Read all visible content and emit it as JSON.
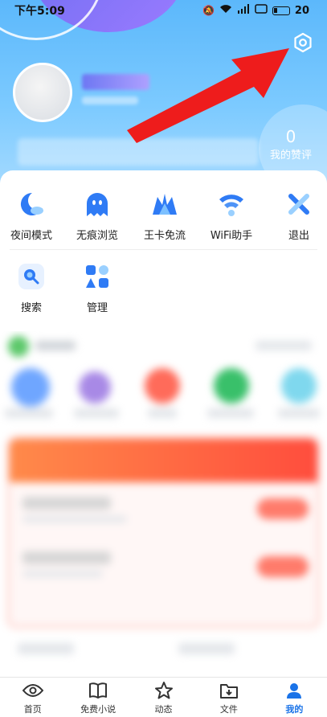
{
  "status_bar": {
    "time": "下午5:09",
    "battery": "20"
  },
  "profile": {
    "praise_count": "0",
    "praise_label": "我的赞评"
  },
  "tools": [
    {
      "label": "夜间模式",
      "icon": "moon-icon"
    },
    {
      "label": "无痕浏览",
      "icon": "ghost-icon"
    },
    {
      "label": "王卡免流",
      "icon": "crown-icon"
    },
    {
      "label": "WiFi助手",
      "icon": "wifi-icon"
    },
    {
      "label": "退出",
      "icon": "close-icon"
    },
    {
      "label": "搜索",
      "icon": "search-icon"
    },
    {
      "label": "管理",
      "icon": "manage-icon"
    }
  ],
  "bottom_nav": [
    {
      "label": "首页",
      "icon": "eye-icon"
    },
    {
      "label": "免费小说",
      "icon": "book-icon"
    },
    {
      "label": "动态",
      "icon": "star-icon"
    },
    {
      "label": "文件",
      "icon": "folder-icon"
    },
    {
      "label": "我的",
      "icon": "user-icon",
      "active": true
    }
  ],
  "colors": {
    "header_blue": "#5cb8fb",
    "accent_blue": "#1a73e8",
    "arrow_red": "#ee1c1c"
  }
}
